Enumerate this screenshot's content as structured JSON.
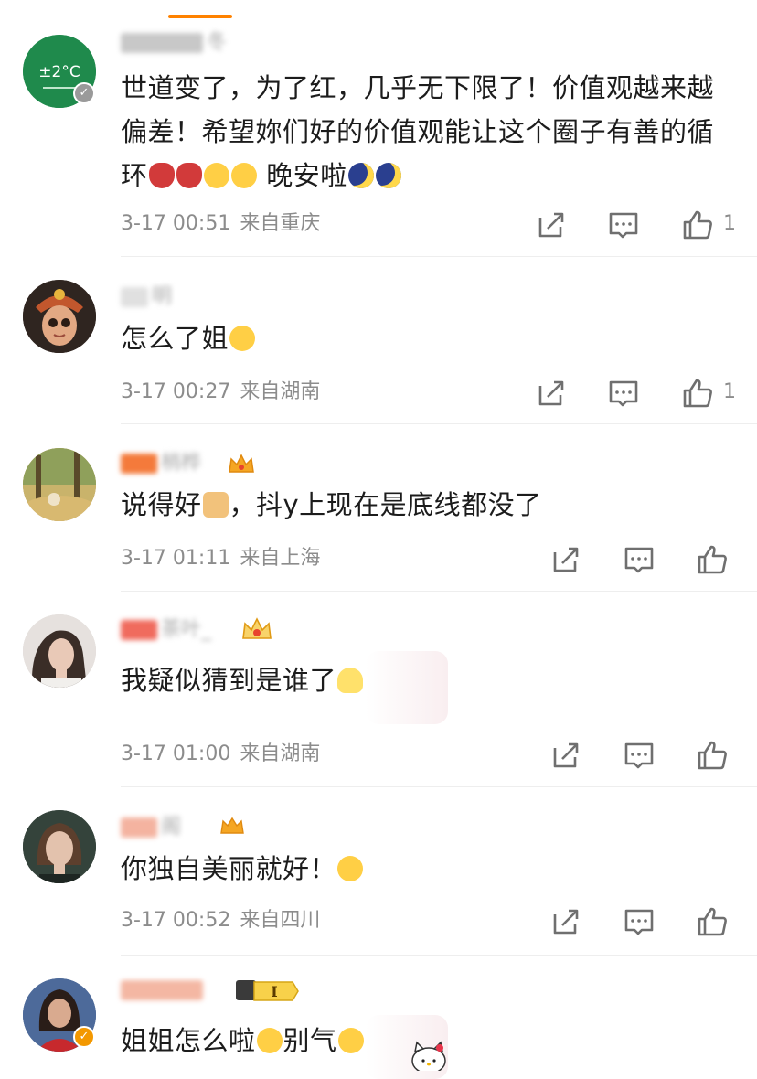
{
  "comments": [
    {
      "username": "冬",
      "text": "世道变了，为了红，几乎无下限了！价值观越来越偏差！希望妳们好的价值观能让这个圈子有善的循环",
      "text_tail": "晚安啦",
      "avatar_label": "±2°C",
      "time": "3-17 00:51",
      "location": "来自重庆",
      "likes": "1"
    },
    {
      "username": "明",
      "text": "怎么了姐",
      "time": "3-17 00:27",
      "location": "来自湖南",
      "likes": "1"
    },
    {
      "username": "梢桦",
      "text": "说得好",
      "text_tail": "，抖y上现在是底线都没了",
      "time": "3-17 01:11",
      "location": "来自上海",
      "likes": ""
    },
    {
      "username": "茶叶_",
      "text": "我疑似猜到是谁了",
      "time": "3-17 01:00",
      "location": "来自湖南",
      "likes": ""
    },
    {
      "username": "阁",
      "text": "你独自美丽就好！",
      "time": "3-17 00:52",
      "location": "来自四川",
      "likes": ""
    },
    {
      "username": "",
      "badge_text": "I",
      "text": "姐姐怎么啦",
      "text_tail": "别气",
      "time": "",
      "location": "",
      "likes": ""
    }
  ],
  "colors": {
    "accent": "#ff8200",
    "meta_gray": "#8c8c8c",
    "icon_gray": "#6f6f6f",
    "vip_gold": "#f5a623",
    "verified_orange": "#f39800"
  },
  "icons": [
    "share-icon",
    "comment-icon",
    "like-icon",
    "crown-icon",
    "verified-icon"
  ]
}
